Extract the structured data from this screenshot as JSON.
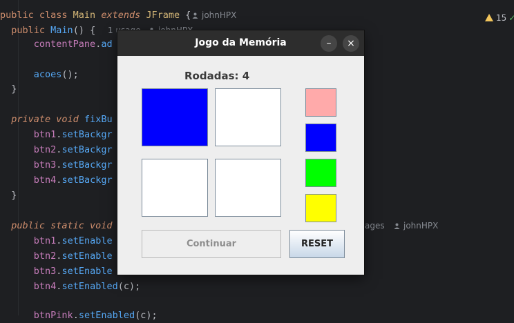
{
  "editor": {
    "lines": [
      {
        "text": "public class Main extends JFrame {"
      },
      {
        "text": "    public Main() {"
      },
      {
        "text": "        contentPane.ad"
      },
      {
        "text": ""
      },
      {
        "text": "        acoes();"
      },
      {
        "text": "    }"
      },
      {
        "text": ""
      },
      {
        "text": "    private void fixBu"
      },
      {
        "text": "        btn1.setBackgr"
      },
      {
        "text": "        btn2.setBackgr"
      },
      {
        "text": "        btn3.setBackgr"
      },
      {
        "text": "        btn4.setBackgr"
      },
      {
        "text": "    }"
      },
      {
        "text": ""
      },
      {
        "text": "    public static void"
      },
      {
        "text": "        btn1.setEnable"
      },
      {
        "text": "        btn2.setEnable"
      },
      {
        "text": "        btn3.setEnable"
      },
      {
        "text": "        btn4.setEnabled(c);"
      },
      {
        "text": ""
      },
      {
        "text": "        btnPink.setEnabled(c);"
      }
    ],
    "author_hint_1": "johnHPX",
    "usages_hint": "1 usage",
    "author_hint_2": "johnHPX",
    "author_hint_3": "ages",
    "author_hint_4": "johnHPX",
    "warning_count": "15",
    "warning_icon": "warning-triangle-icon",
    "check_icon": "check-icon"
  },
  "dialog": {
    "title": "Jogo da Memória",
    "minimize_symbol": "–",
    "close_symbol": "×",
    "rounds_label": "Rodadas: 4",
    "tiles": [
      {
        "color": "#0000ff"
      },
      {
        "color": "#ffffff"
      },
      {
        "color": "#ffffff"
      },
      {
        "color": "#ffffff"
      }
    ],
    "swatches": [
      {
        "color": "#ffaaaa"
      },
      {
        "color": "#0000ff"
      },
      {
        "color": "#00ff00"
      },
      {
        "color": "#ffff00"
      }
    ],
    "continue_label": "Continuar",
    "reset_label": "RESET"
  }
}
